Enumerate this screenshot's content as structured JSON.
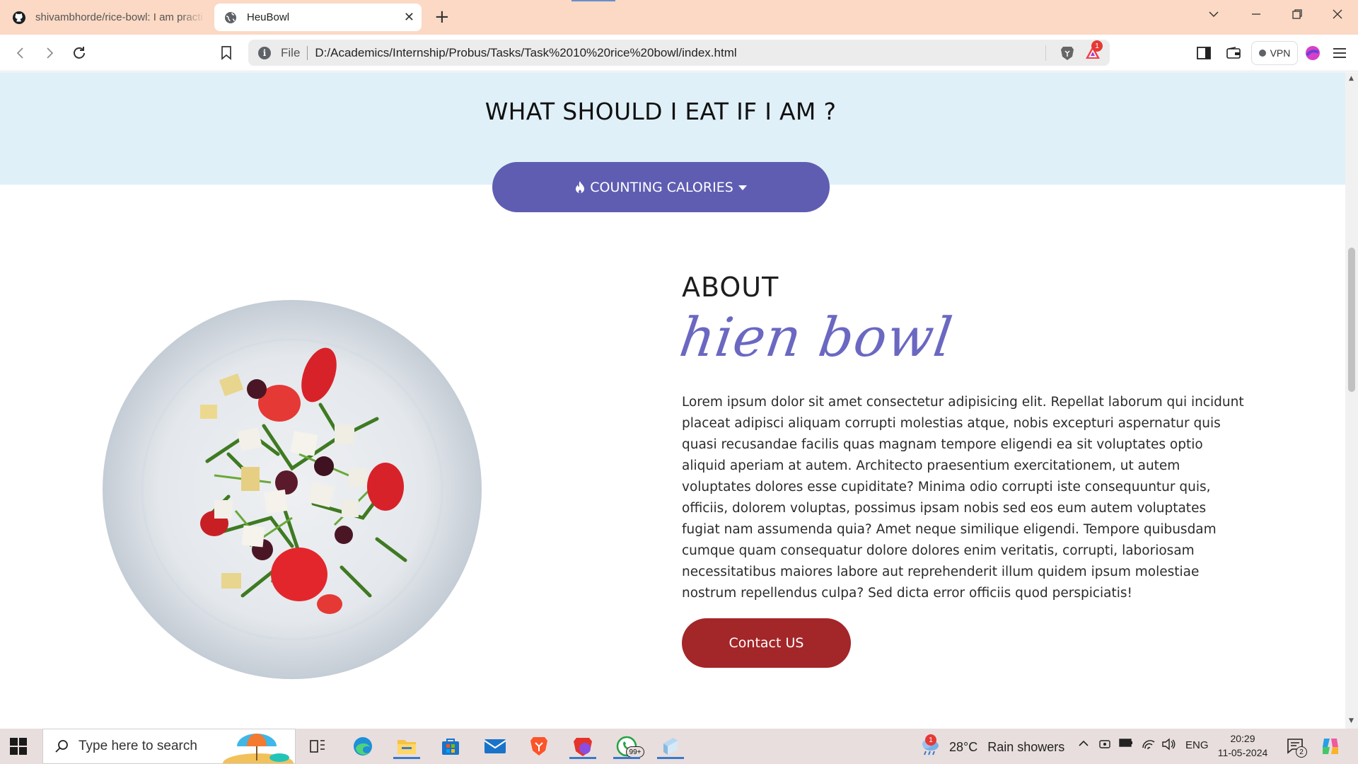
{
  "browser": {
    "tabs": [
      {
        "label": "shivambhorde/rice-bowl: I am practi",
        "icon": "github-icon"
      },
      {
        "label": "HeuBowl",
        "icon": "globe-icon"
      }
    ],
    "url_scheme_label": "File",
    "url": "D:/Academics/Internship/Probus/Tasks/Task%2010%20rice%20bowl/index.html",
    "vpn_label": "VPN",
    "notification_count": "1"
  },
  "page": {
    "question": "WHAT SHOULD I EAT IF I AM ?",
    "calorie_button": {
      "label": "COUNTING CALORIES",
      "icon": "flame-icon",
      "caret": "caret-down-icon"
    },
    "about": {
      "title": "ABOUT",
      "script_title": "hien bowl",
      "text": "Lorem ipsum dolor sit amet consectetur adipisicing elit. Repellat laborum qui incidunt placeat adipisci aliquam corrupti molestias atque, nobis excepturi aspernatur quis quasi recusandae facilis quas magnam tempore eligendi ea sit voluptates optio aliquid aperiam at autem. Architecto praesentium exercitationem, ut autem voluptates dolores esse cupiditate? Minima odio corrupti iste consequuntur quis, officiis, dolorem voluptas, possimus ipsam nobis sed eos eum autem voluptates fugiat nam assumenda quia? Amet neque similique eligendi. Tempore quibusdam cumque quam consequatur dolore dolores enim veritatis, corrupti, laboriosam necessitatibus maiores labore aut reprehenderit illum quidem ipsum molestiae nostrum repellendus culpa? Sed dicta error officiis quod perspiciatis!",
      "contact_button": "Contact US"
    },
    "colors": {
      "accent": "#5f5db2",
      "contact": "#a32629",
      "banner": "#e0f0f8"
    }
  },
  "taskbar": {
    "search_placeholder": "Type here to search",
    "whatsapp_badge": "99+",
    "weather": {
      "temp": "28°C",
      "condition": "Rain showers",
      "badge": "1"
    },
    "language": "ENG",
    "time": "20:29",
    "date": "11-05-2024",
    "notifications": "2"
  }
}
